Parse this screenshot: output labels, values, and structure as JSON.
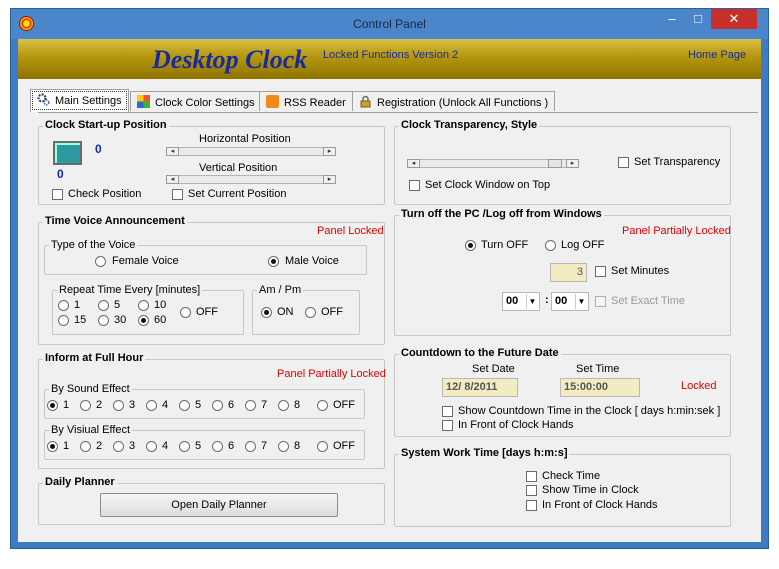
{
  "window": {
    "title": "Control Panel",
    "min_label": "‒",
    "max_label": "□",
    "close_label": "✕"
  },
  "banner": {
    "title": "Desktop Clock",
    "subtitle": "Locked Functions Version 2",
    "home_link": "Home Page"
  },
  "tabs": [
    {
      "label": "Main Settings"
    },
    {
      "label": "Clock Color Settings"
    },
    {
      "label": "RSS Reader"
    },
    {
      "label": "Registration    (Unlock All Functions )"
    }
  ],
  "startup": {
    "title": "Clock Start-up Position",
    "h_label": "Horizontal Position",
    "v_label": "Vertical Position",
    "x_value": "0",
    "y_value": "0",
    "check_position": "Check Position",
    "set_current": "Set Current Position"
  },
  "voice": {
    "title": "Time Voice Announcement",
    "locked": "Panel Locked",
    "type_title": "Type of the Voice",
    "female": "Female Voice",
    "male": "Male Voice",
    "repeat_title": "Repeat Time Every  [minutes]",
    "r1": "1",
    "r5": "5",
    "r10": "10",
    "r15": "15",
    "r30": "30",
    "r60": "60",
    "off": "OFF",
    "ampm_title": "Am / Pm",
    "on": "ON",
    "ampm_off": "OFF"
  },
  "hour": {
    "title": "Inform at Full Hour",
    "locked": "Panel Partially Locked",
    "sound_title": "By Sound Effect",
    "visual_title": "By Visiual Effect",
    "nums": [
      "1",
      "2",
      "3",
      "4",
      "5",
      "6",
      "7",
      "8"
    ],
    "off": "OFF"
  },
  "planner": {
    "title": "Daily Planner",
    "button": "Open Daily Planner"
  },
  "transparency": {
    "title": "Clock Transparency, Style",
    "set_transparency": "Set Transparency",
    "on_top": "Set Clock Window on Top"
  },
  "turnoff": {
    "title": "Turn off the PC /Log off from Windows",
    "locked": "Panel Partially Locked",
    "turn_off": "Turn OFF",
    "log_off": "Log OFF",
    "minutes_value": "3",
    "set_minutes": "Set Minutes",
    "hour_value": "00",
    "min_value": "00",
    "colon": ":",
    "exact_time": "Set Exact Time"
  },
  "countdown": {
    "title": "Countdown to the Future Date",
    "date_label": "Set Date",
    "time_label": "Set Time",
    "date_value": "12/  8/2011",
    "time_value": "15:00:00",
    "locked": "Locked",
    "show_countdown": "Show Countdown Time in the Clock  [ days  h:min:sek ]",
    "in_front": "In Front of Clock Hands"
  },
  "worktime": {
    "title": "System Work Time [days h:m:s]",
    "check": "Check Time",
    "show": "Show Time in Clock",
    "front": "In Front of Clock Hands"
  }
}
